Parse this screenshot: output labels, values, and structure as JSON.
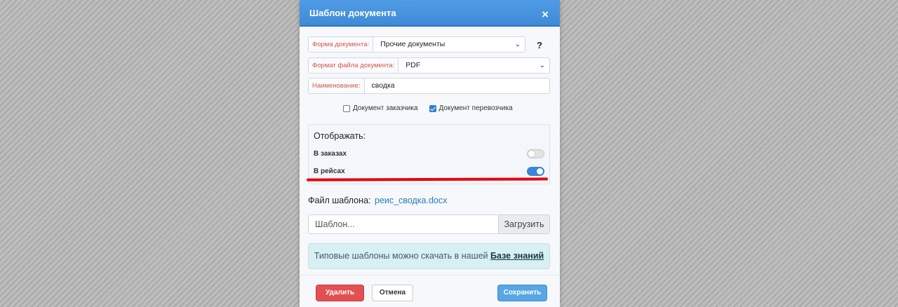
{
  "dialog": {
    "title": "Шаблон документа",
    "close_label": "×"
  },
  "form": {
    "document_form": {
      "label": "Форма документа:",
      "value": "Прочие документы"
    },
    "file_format": {
      "label": "Формат файла документа:",
      "value": "PDF"
    },
    "name": {
      "label": "Наименование:",
      "value": "сводка"
    },
    "help_label": "?"
  },
  "checkboxes": [
    {
      "label": "Документ заказчика",
      "checked": false
    },
    {
      "label": "Документ перевозчика",
      "checked": true
    }
  ],
  "display": {
    "title": "Отображать:",
    "toggles": [
      {
        "label": "В заказах",
        "on": false
      },
      {
        "label": "В рейсах",
        "on": true
      }
    ]
  },
  "template_file": {
    "label": "Файл шаблона:",
    "file_name": "реис_сводка.docx",
    "input_placeholder": "Шаблон...",
    "upload_label": "Загрузить"
  },
  "info": {
    "text": "Типовые шаблоны можно скачать в нашей ",
    "link": "Базе знаний"
  },
  "footer": {
    "delete_label": "Удалить",
    "cancel_label": "Отмена",
    "save_label": "Сохранить"
  },
  "colors": {
    "header": "#4a96e0",
    "delete": "#e25052",
    "save": "#58a6e4",
    "annotation_underline": "#e8000a"
  }
}
